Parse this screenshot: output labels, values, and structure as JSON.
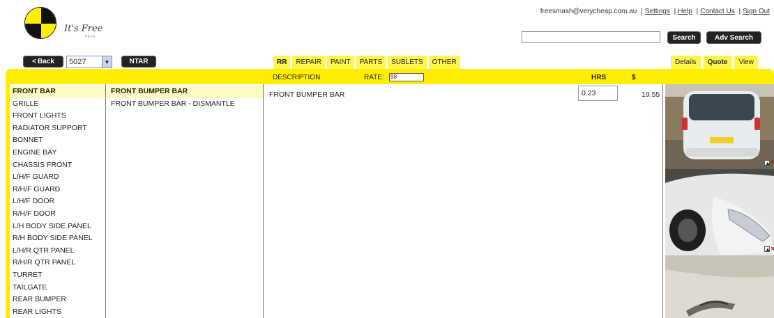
{
  "header": {
    "logo_text": "It's Free",
    "logo_sub": "BETA",
    "user_email": "freesmash@verycheap.com.au",
    "links": [
      "Settings",
      "Help",
      "Contact Us",
      "Sign Out"
    ],
    "search_value": "",
    "search_label": "Search",
    "adv_search_label": "Adv Search"
  },
  "toolbar": {
    "back_label": "Back",
    "job_number": "5027",
    "ntar_label": "NTAR"
  },
  "tabs": [
    {
      "label": "RR",
      "active": true
    },
    {
      "label": "REPAIR",
      "active": false
    },
    {
      "label": "PAINT",
      "active": false
    },
    {
      "label": "PARTS",
      "active": false
    },
    {
      "label": "SUBLETS",
      "active": false
    },
    {
      "label": "OTHER",
      "active": false
    }
  ],
  "right_tabs": [
    {
      "label": "Details",
      "active": false
    },
    {
      "label": "Quote",
      "active": true
    },
    {
      "label": "View",
      "active": false
    }
  ],
  "columns": {
    "description": "DESCRIPTION",
    "rate": "RATE:",
    "rate_value": "98",
    "hrs": "HRS",
    "amount": "$"
  },
  "sections": [
    "FRONT BAR",
    "GRILLE",
    "FRONT LIGHTS",
    "RADIATOR SUPPORT",
    "BONNET",
    "ENGINE BAY",
    "CHASSIS FRONT",
    "L/H/F GUARD",
    "R/H/F GUARD",
    "L/H/F DOOR",
    "R/H/F DOOR",
    "L/H BODY SIDE PANEL",
    "R/H BODY SIDE PANEL",
    "L/H/R QTR PANEL",
    "R/H/R QTR PANEL",
    "TURRET",
    "TAILGATE",
    "REAR BUMPER",
    "REAR LIGHTS"
  ],
  "operations": [
    "FRONT BUMPER BAR",
    "FRONT BUMPER BAR - DISMANTLE"
  ],
  "quote_line": {
    "description": "FRONT BUMPER BAR",
    "hrs": "0.23",
    "amount": "19.55"
  },
  "colors": {
    "accent": "#ffee00",
    "tab": "#fff64a",
    "button_dark": "#222222"
  }
}
